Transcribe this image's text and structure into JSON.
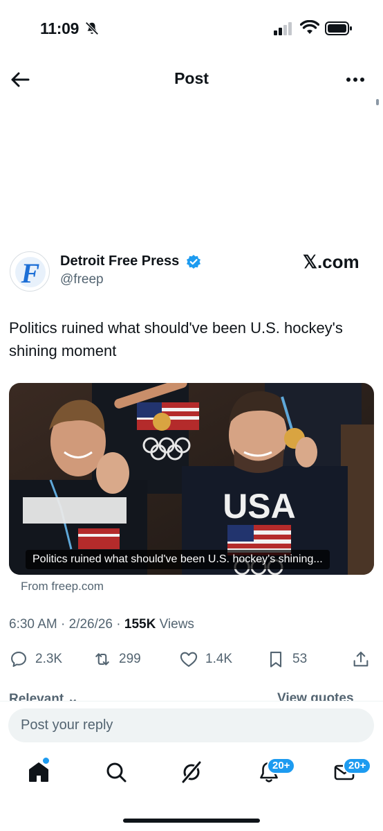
{
  "status_bar": {
    "time": "11:09"
  },
  "header": {
    "title": "Post"
  },
  "author": {
    "name": "Detroit Free Press",
    "handle": "@freep",
    "avatar_letter": "F"
  },
  "watermark": "𝕏.com",
  "post": {
    "text": "Politics ruined what should've been U.S. hockey's shining moment",
    "timestamp": "6:30 AM · 2/26/26 · ",
    "views_count": "155K",
    "views_label": " Views"
  },
  "link_card": {
    "caption": "Politics ruined what should've been U.S. hockey's shining...",
    "source": "From freep.com",
    "image_sweater_text": "USA"
  },
  "actions": {
    "replies": "2.3K",
    "reposts": "299",
    "likes": "1.4K",
    "bookmarks": "53"
  },
  "sort": {
    "label": "Relevant",
    "view_quotes": "View quotes"
  },
  "reply_box": {
    "placeholder": "Post your reply"
  },
  "nav": {
    "notifications_badge": "20+",
    "messages_badge": "20+"
  },
  "colors": {
    "accent": "#1d9bf0",
    "text": "#0f1419",
    "secondary": "#536471",
    "reply_bg": "#eff3f4"
  }
}
